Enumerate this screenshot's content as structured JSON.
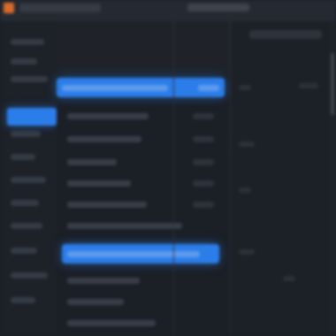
{
  "colors": {
    "background": "#1b1f26",
    "accent_blue": "#2b7de9",
    "app_logo": "#d96a2a"
  },
  "icons": [
    "app-logo-icon"
  ],
  "main_list": {
    "selected_indices": [
      0,
      9
    ]
  }
}
